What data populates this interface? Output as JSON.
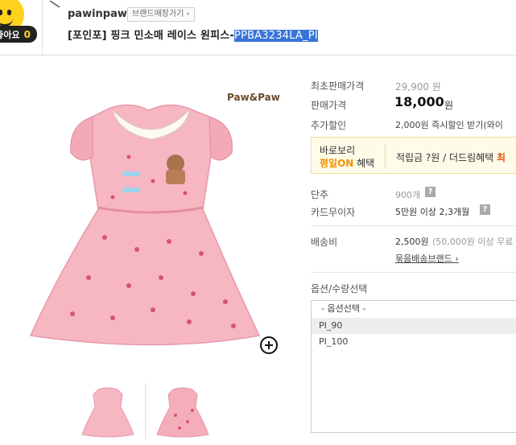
{
  "header": {
    "like_label": "좋아요",
    "like_count": "0",
    "brand_name": "pawinpaw",
    "brand_store_button": "브랜드매장가기",
    "title_main": "[포인포] 핑크 민소매 레이스 원피스-",
    "title_code": "PPBA3234LA_PI"
  },
  "image": {
    "logo_text": "Paw&Paw"
  },
  "price": {
    "lowest_label": "최초판매가격",
    "lowest_value": "29,900 원",
    "sale_label": "판매가격",
    "sale_value": "18,000",
    "sale_unit": "원",
    "extra_label": "추가할인",
    "extra_value": "2,000원 즉시할인 받기(와이"
  },
  "promo": {
    "left_line1": "바로보리",
    "left_line2_highlight": "평일ON",
    "left_line2_rest": " 혜택",
    "right_text": "적립금 ?원 / 더드림혜택 ",
    "right_highlight": "최"
  },
  "details": {
    "short_label": "단추",
    "short_value": "900개",
    "card_label": "카드무이자",
    "card_value": "5만원 이상 2,3개월",
    "ship_label": "배송비",
    "ship_value": "2,500원",
    "ship_extra": "(50,000원 이상 무료",
    "bundle_link": "묶음배송브랜드",
    "help_glyph": "?"
  },
  "options": {
    "label": "옵션/수량선택",
    "header": "- 옵션선택 -",
    "items": [
      "PI_90",
      "PI_100"
    ]
  },
  "colors": {
    "highlight": "#3874d8",
    "accent_orange": "#f29100",
    "accent_red": "#e8580c",
    "like_yellow": "#ffd21e"
  }
}
